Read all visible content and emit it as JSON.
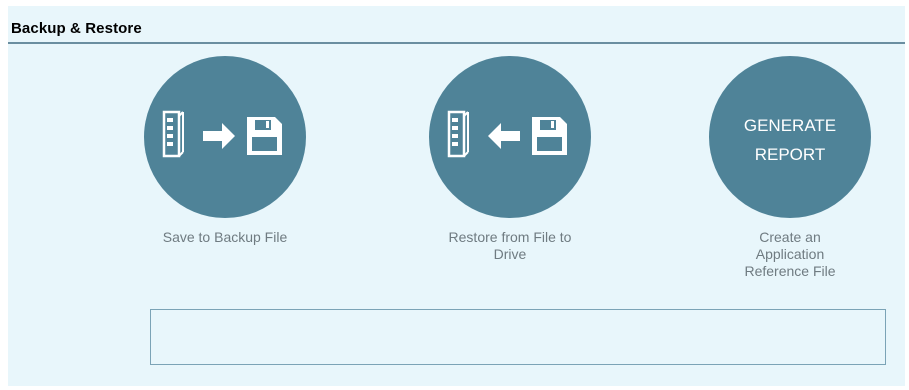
{
  "panel": {
    "title": "Backup & Restore"
  },
  "actions": {
    "save": {
      "caption": "Save to Backup File",
      "icons": [
        "drive-icon",
        "arrow-right-icon",
        "floppy-disk-icon"
      ]
    },
    "restore": {
      "caption": "Restore from File to\nDrive",
      "icons": [
        "drive-icon",
        "arrow-left-icon",
        "floppy-disk-icon"
      ]
    },
    "report": {
      "button_text": "GENERATE\nREPORT",
      "caption": "Create an\nApplication\nReference File"
    }
  },
  "log": {
    "text": ""
  },
  "colors": {
    "panel_bg": "#e8f6fb",
    "circle": "#4f8398",
    "header_line": "#6a8ea0",
    "caption_text": "#6f7b81"
  }
}
